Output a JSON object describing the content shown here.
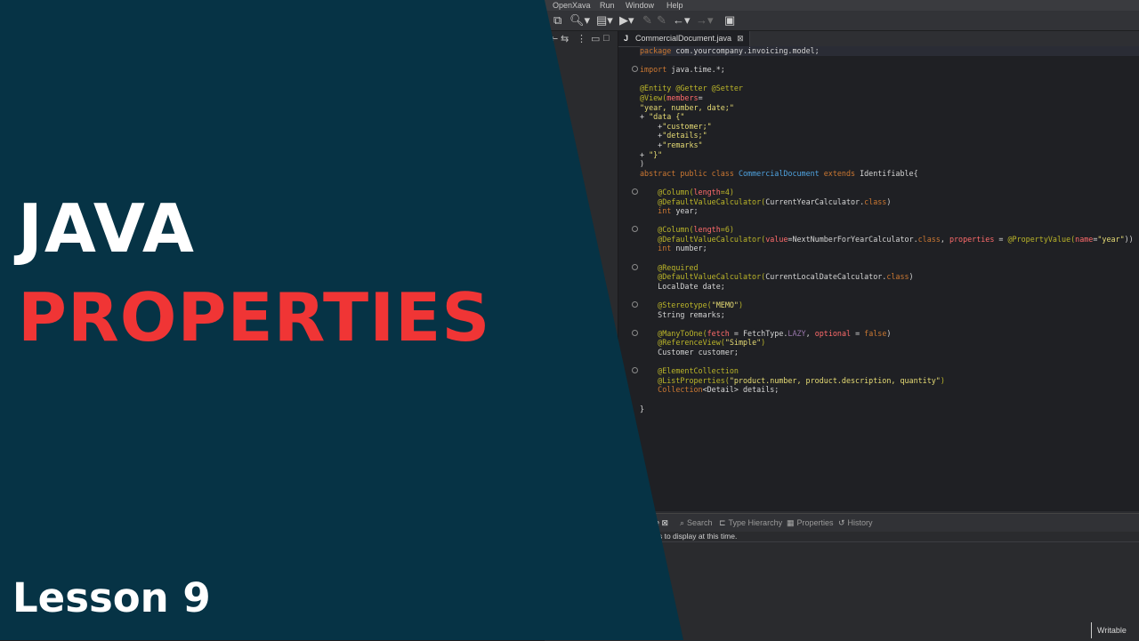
{
  "menubar": {
    "items": [
      "OpenXava",
      "Run",
      "Window",
      "Help"
    ]
  },
  "toolbar": {
    "icons": [
      "sync-icon",
      "search-icon",
      "new-package-icon",
      "run-icon",
      "forward-nav-icon",
      "back-nav-icon",
      "left-arrow-icon",
      "right-arrow-icon",
      "restore-window-icon"
    ]
  },
  "editor": {
    "tab_label": "CommercialDocument.java",
    "code": [
      {
        "segs": [
          {
            "t": "package ",
            "c": "#cc7832"
          },
          {
            "t": "com.yourcompany.invoicing.model;",
            "c": "#d4d4d4"
          }
        ]
      },
      {
        "segs": []
      },
      {
        "fold": true,
        "segs": [
          {
            "t": "import ",
            "c": "#cc7832"
          },
          {
            "t": "java.time.*;",
            "c": "#d4d4d4"
          }
        ]
      },
      {
        "segs": []
      },
      {
        "segs": [
          {
            "t": "@Entity @Getter @Setter",
            "c": "#bbb529"
          }
        ]
      },
      {
        "segs": [
          {
            "t": "@View(",
            "c": "#bbb529"
          },
          {
            "t": "members",
            "c": "#ff6b6b"
          },
          {
            "t": "=",
            "c": "#d4d4d4"
          }
        ]
      },
      {
        "segs": [
          {
            "t": "\"year, number, date;\"",
            "c": "#e6db74"
          }
        ]
      },
      {
        "segs": [
          {
            "t": "+ ",
            "c": "#d4d4d4"
          },
          {
            "t": "\"data {\"",
            "c": "#e6db74"
          }
        ]
      },
      {
        "segs": [
          {
            "t": "    +",
            "c": "#d4d4d4"
          },
          {
            "t": "\"customer;\"",
            "c": "#e6db74"
          }
        ]
      },
      {
        "segs": [
          {
            "t": "    +",
            "c": "#d4d4d4"
          },
          {
            "t": "\"details;\"",
            "c": "#e6db74"
          }
        ]
      },
      {
        "segs": [
          {
            "t": "    +",
            "c": "#d4d4d4"
          },
          {
            "t": "\"remarks\"",
            "c": "#e6db74"
          }
        ]
      },
      {
        "segs": [
          {
            "t": "+ ",
            "c": "#d4d4d4"
          },
          {
            "t": "\"}\"",
            "c": "#e6db74"
          }
        ]
      },
      {
        "segs": [
          {
            "t": ")",
            "c": "#d4d4d4"
          }
        ]
      },
      {
        "segs": [
          {
            "t": "abstract public class ",
            "c": "#cc7832"
          },
          {
            "t": "CommercialDocument ",
            "c": "#4fa3e0"
          },
          {
            "t": "extends ",
            "c": "#cc7832"
          },
          {
            "t": "Identifiable{",
            "c": "#d4d4d4"
          }
        ]
      },
      {
        "segs": []
      },
      {
        "fold": true,
        "segs": [
          {
            "t": "    @Column(",
            "c": "#bbb529"
          },
          {
            "t": "length",
            "c": "#ff6b6b"
          },
          {
            "t": "=4)",
            "c": "#bbb529"
          }
        ]
      },
      {
        "segs": [
          {
            "t": "    @DefaultValueCalculator(",
            "c": "#bbb529"
          },
          {
            "t": "CurrentYearCalculator.",
            "c": "#d4d4d4"
          },
          {
            "t": "class",
            "c": "#cc7832"
          },
          {
            "t": ")",
            "c": "#d4d4d4"
          }
        ]
      },
      {
        "segs": [
          {
            "t": "    int ",
            "c": "#cc7832"
          },
          {
            "t": "year;",
            "c": "#d4d4d4"
          }
        ]
      },
      {
        "segs": []
      },
      {
        "fold": true,
        "segs": [
          {
            "t": "    @Column(",
            "c": "#bbb529"
          },
          {
            "t": "length",
            "c": "#ff6b6b"
          },
          {
            "t": "=6)",
            "c": "#bbb529"
          }
        ]
      },
      {
        "segs": [
          {
            "t": "    @DefaultValueCalculator(",
            "c": "#bbb529"
          },
          {
            "t": "value",
            "c": "#ff6b6b"
          },
          {
            "t": "=NextNumberForYearCalculator.",
            "c": "#d4d4d4"
          },
          {
            "t": "class",
            "c": "#cc7832"
          },
          {
            "t": ", ",
            "c": "#d4d4d4"
          },
          {
            "t": "properties",
            "c": "#ff6b6b"
          },
          {
            "t": " = ",
            "c": "#d4d4d4"
          },
          {
            "t": "@PropertyValue(",
            "c": "#bbb529"
          },
          {
            "t": "name",
            "c": "#ff6b6b"
          },
          {
            "t": "=",
            "c": "#d4d4d4"
          },
          {
            "t": "\"year\"",
            "c": "#e6db74"
          },
          {
            "t": "))",
            "c": "#d4d4d4"
          }
        ]
      },
      {
        "segs": [
          {
            "t": "    int ",
            "c": "#cc7832"
          },
          {
            "t": "number;",
            "c": "#d4d4d4"
          }
        ]
      },
      {
        "segs": []
      },
      {
        "fold": true,
        "segs": [
          {
            "t": "    @Required",
            "c": "#bbb529"
          }
        ]
      },
      {
        "segs": [
          {
            "t": "    @DefaultValueCalculator(",
            "c": "#bbb529"
          },
          {
            "t": "CurrentLocalDateCalculator.",
            "c": "#d4d4d4"
          },
          {
            "t": "class",
            "c": "#cc7832"
          },
          {
            "t": ")",
            "c": "#d4d4d4"
          }
        ]
      },
      {
        "segs": [
          {
            "t": "    LocalDate ",
            "c": "#d4d4d4"
          },
          {
            "t": "date;",
            "c": "#d4d4d4"
          }
        ]
      },
      {
        "segs": []
      },
      {
        "fold": true,
        "segs": [
          {
            "t": "    @Stereotype(",
            "c": "#bbb529"
          },
          {
            "t": "\"MEMO\"",
            "c": "#e6db74"
          },
          {
            "t": ")",
            "c": "#bbb529"
          }
        ]
      },
      {
        "segs": [
          {
            "t": "    String ",
            "c": "#d4d4d4"
          },
          {
            "t": "remarks;",
            "c": "#d4d4d4"
          }
        ]
      },
      {
        "segs": []
      },
      {
        "fold": true,
        "segs": [
          {
            "t": "    @ManyToOne(",
            "c": "#bbb529"
          },
          {
            "t": "fetch",
            "c": "#ff6b6b"
          },
          {
            "t": " = FetchType.",
            "c": "#d4d4d4"
          },
          {
            "t": "LAZY",
            "c": "#9876aa"
          },
          {
            "t": ", ",
            "c": "#d4d4d4"
          },
          {
            "t": "optional",
            "c": "#ff6b6b"
          },
          {
            "t": " = ",
            "c": "#d4d4d4"
          },
          {
            "t": "false",
            "c": "#cc7832"
          },
          {
            "t": ")",
            "c": "#d4d4d4"
          }
        ]
      },
      {
        "segs": [
          {
            "t": "    @ReferenceView(",
            "c": "#bbb529"
          },
          {
            "t": "\"Simple\"",
            "c": "#e6db74"
          },
          {
            "t": ")",
            "c": "#bbb529"
          }
        ]
      },
      {
        "segs": [
          {
            "t": "    Customer ",
            "c": "#d4d4d4"
          },
          {
            "t": "customer;",
            "c": "#d4d4d4"
          }
        ]
      },
      {
        "segs": []
      },
      {
        "fold": true,
        "segs": [
          {
            "t": "    @ElementCollection",
            "c": "#bbb529"
          }
        ]
      },
      {
        "segs": [
          {
            "t": "    @ListProperties(",
            "c": "#bbb529"
          },
          {
            "t": "\"product.number, product.description, quantity\"",
            "c": "#e6db74"
          },
          {
            "t": ")",
            "c": "#bbb529"
          }
        ]
      },
      {
        "segs": [
          {
            "t": "    Collection",
            "c": "#cc7832"
          },
          {
            "t": "<Detail> ",
            "c": "#d4d4d4"
          },
          {
            "t": "details;",
            "c": "#d4d4d4"
          }
        ]
      },
      {
        "segs": []
      },
      {
        "segs": [
          {
            "t": "}",
            "c": "#d4d4d4"
          }
        ]
      }
    ]
  },
  "bottom_panel": {
    "tabs": [
      "le",
      "Search",
      "Type Hierarchy",
      "Properties",
      "History"
    ],
    "message": "s to display at this time."
  },
  "status": {
    "writable": "Writable"
  },
  "overlay": {
    "title_line1": "JAVA",
    "title_line2": "PROPERTIES",
    "lesson": "Lesson 9",
    "colors": {
      "background": "#063345",
      "accent": "#f03535",
      "text": "#ffffff"
    }
  }
}
